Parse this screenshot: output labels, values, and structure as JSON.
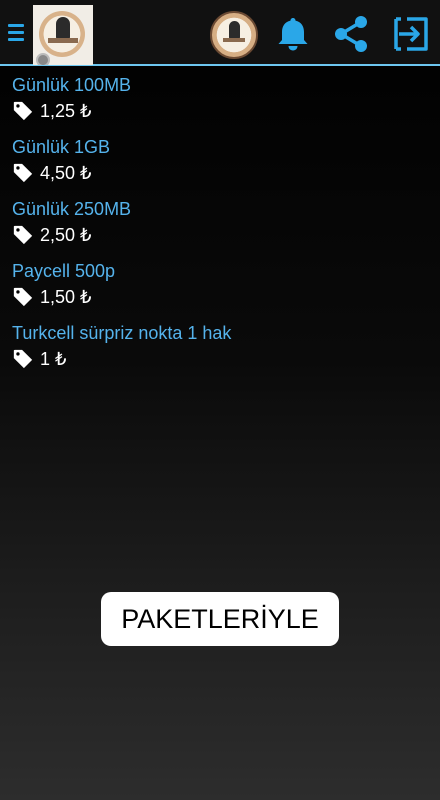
{
  "colors": {
    "accent": "#2aa7e8",
    "item_name": "#55b3ec",
    "divider": "#6ec7f0",
    "price_text": "#ffffff",
    "toast_bg": "#ffffff"
  },
  "header": {
    "menu_icon": "hamburger-menu-icon",
    "icons": [
      "bell-icon",
      "share-icon",
      "logout-icon"
    ]
  },
  "packages": [
    {
      "name": "Günlük 100MB",
      "price": "1,25 ₺"
    },
    {
      "name": "Günlük 1GB",
      "price": "4,50 ₺"
    },
    {
      "name": "Günlük 250MB",
      "price": "2,50 ₺"
    },
    {
      "name": "Paycell 500p",
      "price": "1,50 ₺"
    },
    {
      "name": "Turkcell sürpriz nokta 1 hak",
      "price": "1 ₺"
    }
  ],
  "toast": {
    "text": "PAKETLERİYLE"
  }
}
